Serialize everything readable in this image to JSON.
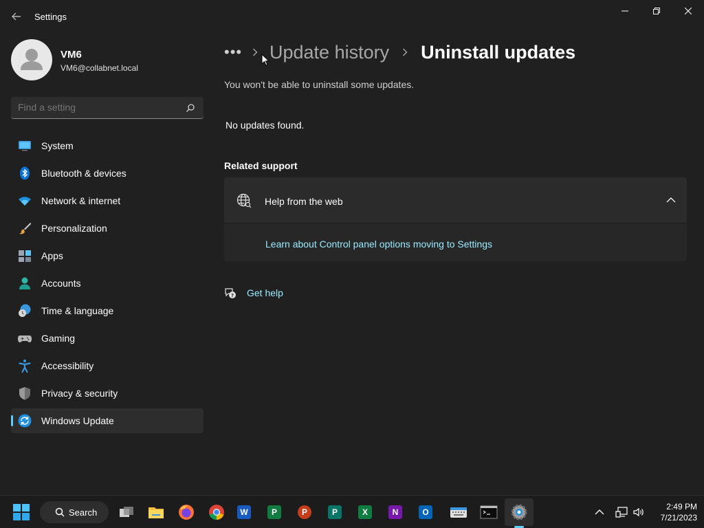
{
  "window": {
    "title": "Settings"
  },
  "profile": {
    "name": "VM6",
    "email": "VM6@collabnet.local"
  },
  "search": {
    "placeholder": "Find a setting"
  },
  "sidebar": {
    "items": [
      {
        "label": "System",
        "icon": "system-icon",
        "active": false
      },
      {
        "label": "Bluetooth & devices",
        "icon": "bluetooth-icon",
        "active": false
      },
      {
        "label": "Network & internet",
        "icon": "wifi-icon",
        "active": false
      },
      {
        "label": "Personalization",
        "icon": "paintbrush-icon",
        "active": false
      },
      {
        "label": "Apps",
        "icon": "apps-icon",
        "active": false
      },
      {
        "label": "Accounts",
        "icon": "accounts-icon",
        "active": false
      },
      {
        "label": "Time & language",
        "icon": "clock-globe-icon",
        "active": false
      },
      {
        "label": "Gaming",
        "icon": "controller-icon",
        "active": false
      },
      {
        "label": "Accessibility",
        "icon": "accessibility-icon",
        "active": false
      },
      {
        "label": "Privacy & security",
        "icon": "shield-icon",
        "active": false
      },
      {
        "label": "Windows Update",
        "icon": "windows-update-icon",
        "active": true
      }
    ]
  },
  "breadcrumb": {
    "more": "•••",
    "previous": "Update history",
    "current": "Uninstall updates"
  },
  "main": {
    "subtitle": "You won't be able to uninstall some updates.",
    "empty_message": "No updates found.",
    "related_heading": "Related support",
    "help_card": {
      "title": "Help from the web",
      "link": "Learn about Control panel options moving to Settings"
    },
    "get_help": "Get help"
  },
  "taskbar": {
    "search_label": "Search",
    "apps": [
      "task-view",
      "file-explorer",
      "firefox",
      "chrome",
      "word",
      "project",
      "powerpoint",
      "publisher",
      "excel",
      "onenote",
      "outlook",
      "on-screen-keyboard",
      "command-prompt",
      "settings"
    ],
    "time": "2:49 PM",
    "date": "7/21/2023"
  },
  "colors": {
    "accent": "#60cdff",
    "link": "#99ebff",
    "background": "#202020"
  }
}
